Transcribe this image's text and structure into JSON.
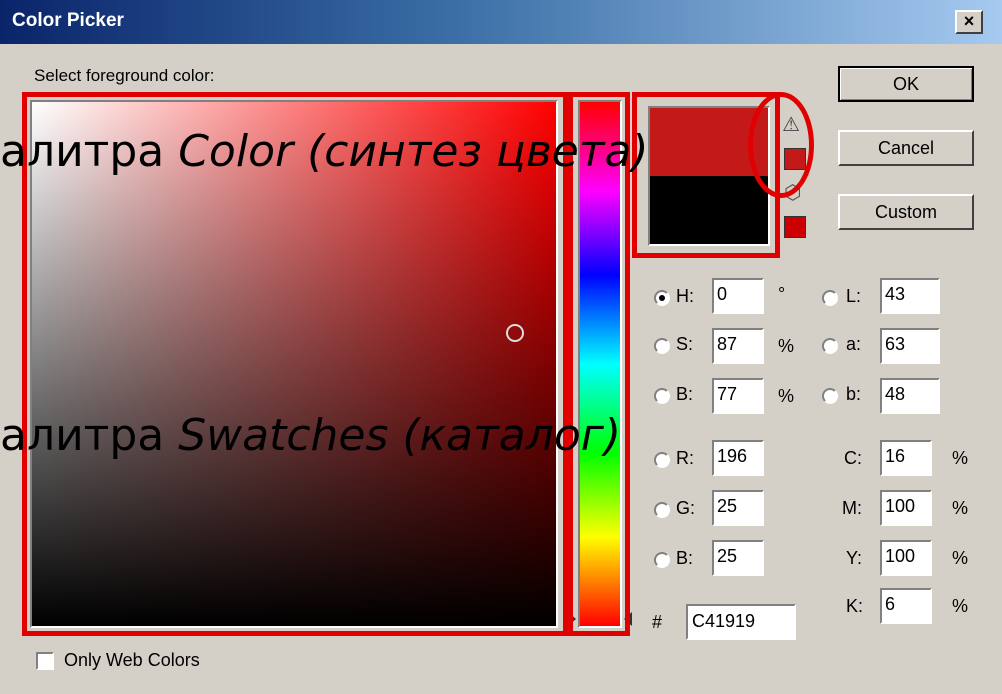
{
  "window": {
    "title": "Color Picker",
    "close_label": "×"
  },
  "prompt": "Select foreground color:",
  "buttons": {
    "ok": "OK",
    "cancel": "Cancel",
    "custom": "Custom"
  },
  "colors": {
    "new": "#C41919",
    "current": "#000000",
    "gamut_swatch": "#C41919",
    "web_swatch": "#CC0000",
    "annotation": "#E00000"
  },
  "hsb": {
    "h_label": "H:",
    "h": "0",
    "h_unit": "°",
    "s_label": "S:",
    "s": "87",
    "s_unit": "%",
    "b_label": "B:",
    "b": "77",
    "b_unit": "%"
  },
  "lab": {
    "l_label": "L:",
    "l": "43",
    "a_label": "a:",
    "a": "63",
    "b_label": "b:",
    "b": "48"
  },
  "rgb": {
    "r_label": "R:",
    "r": "196",
    "g_label": "G:",
    "g": "25",
    "b_label": "B:",
    "b": "25"
  },
  "cmyk": {
    "c_label": "C:",
    "c": "16",
    "c_unit": "%",
    "m_label": "M:",
    "m": "100",
    "m_unit": "%",
    "y_label": "Y:",
    "y": "100",
    "y_unit": "%",
    "k_label": "K:",
    "k": "6",
    "k_unit": "%"
  },
  "hex": {
    "label": "#",
    "value": "C41919"
  },
  "only_web_colors": "Only Web Colors",
  "icons": {
    "gamut_warning": "warning-triangle-icon",
    "web_safe": "cube-icon"
  },
  "overlays": {
    "color_prefix": "алитра ",
    "color_italic": "Color (синтез цвета)",
    "swatches_prefix": "алитра ",
    "swatches_italic": "Swatches (каталог)"
  }
}
